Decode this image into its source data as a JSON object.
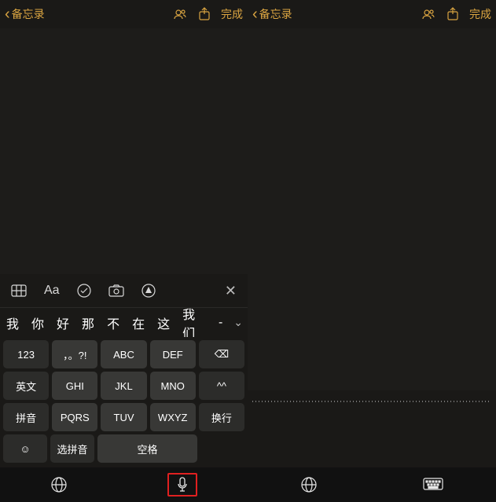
{
  "colors": {
    "accent": "#d9a441"
  },
  "left": {
    "nav": {
      "back": "备忘录",
      "done": "完成"
    },
    "toolbar": {
      "text": "Aa"
    },
    "candidates": [
      "我",
      "你",
      "好",
      "那",
      "不",
      "在",
      "这",
      "我们",
      "-"
    ],
    "keys": {
      "row1": [
        "123",
        "，。?!",
        "ABC",
        "DEF"
      ],
      "row2": [
        "英文",
        "GHI",
        "JKL",
        "MNO"
      ],
      "row3": [
        "拼音",
        "PQRS",
        "TUV",
        "WXYZ"
      ],
      "row4": [
        "选拼音",
        "空格"
      ],
      "backspace": "⌫",
      "shift": "^^",
      "enter": "换行",
      "emoji": "☺"
    }
  },
  "right": {
    "nav": {
      "back": "备忘录",
      "done": "完成"
    }
  }
}
